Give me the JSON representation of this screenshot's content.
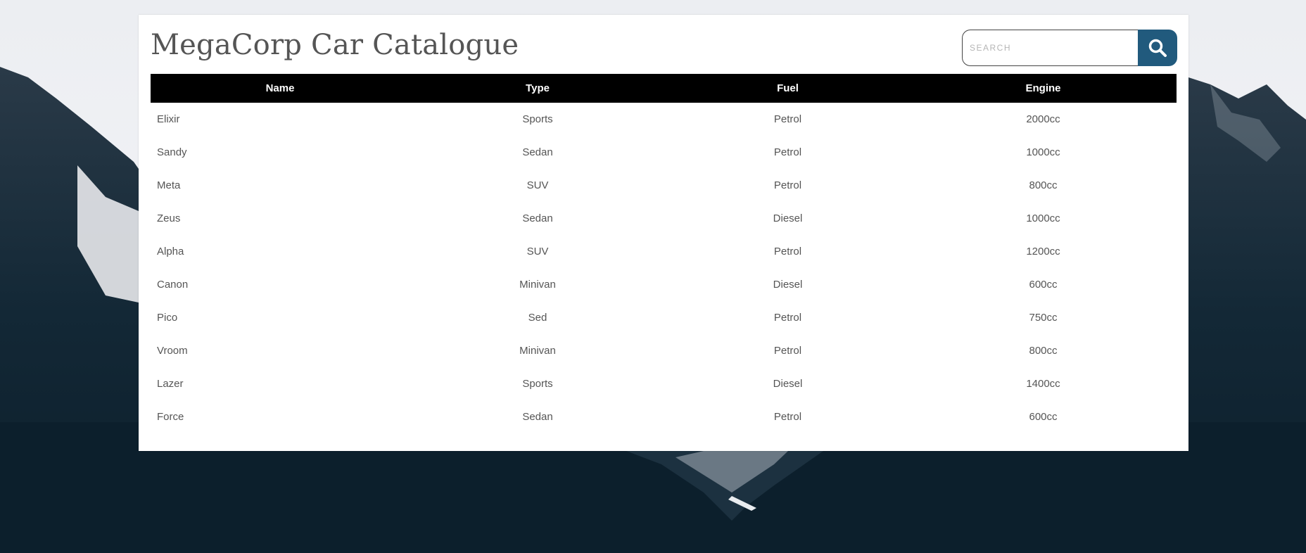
{
  "page": {
    "title": "MegaCorp Car Catalogue"
  },
  "search": {
    "placeholder": "SEARCH",
    "value": "",
    "button_icon": "search-icon"
  },
  "table": {
    "headers": [
      "Name",
      "Type",
      "Fuel",
      "Engine"
    ],
    "rows": [
      [
        "Elixir",
        "Sports",
        "Petrol",
        "2000cc"
      ],
      [
        "Sandy",
        "Sedan",
        "Petrol",
        "1000cc"
      ],
      [
        "Meta",
        "SUV",
        "Petrol",
        "800cc"
      ],
      [
        "Zeus",
        "Sedan",
        "Diesel",
        "1000cc"
      ],
      [
        "Alpha",
        "SUV",
        "Petrol",
        "1200cc"
      ],
      [
        "Canon",
        "Minivan",
        "Diesel",
        "600cc"
      ],
      [
        "Pico",
        "Sed",
        "Petrol",
        "750cc"
      ],
      [
        "Vroom",
        "Minivan",
        "Petrol",
        "800cc"
      ],
      [
        "Lazer",
        "Sports",
        "Diesel",
        "1400cc"
      ],
      [
        "Force",
        "Sedan",
        "Petrol",
        "600cc"
      ]
    ]
  },
  "colors": {
    "header_bg": "#000000",
    "search_button": "#215a7d",
    "title_text": "#555555",
    "cell_text": "#555555"
  }
}
